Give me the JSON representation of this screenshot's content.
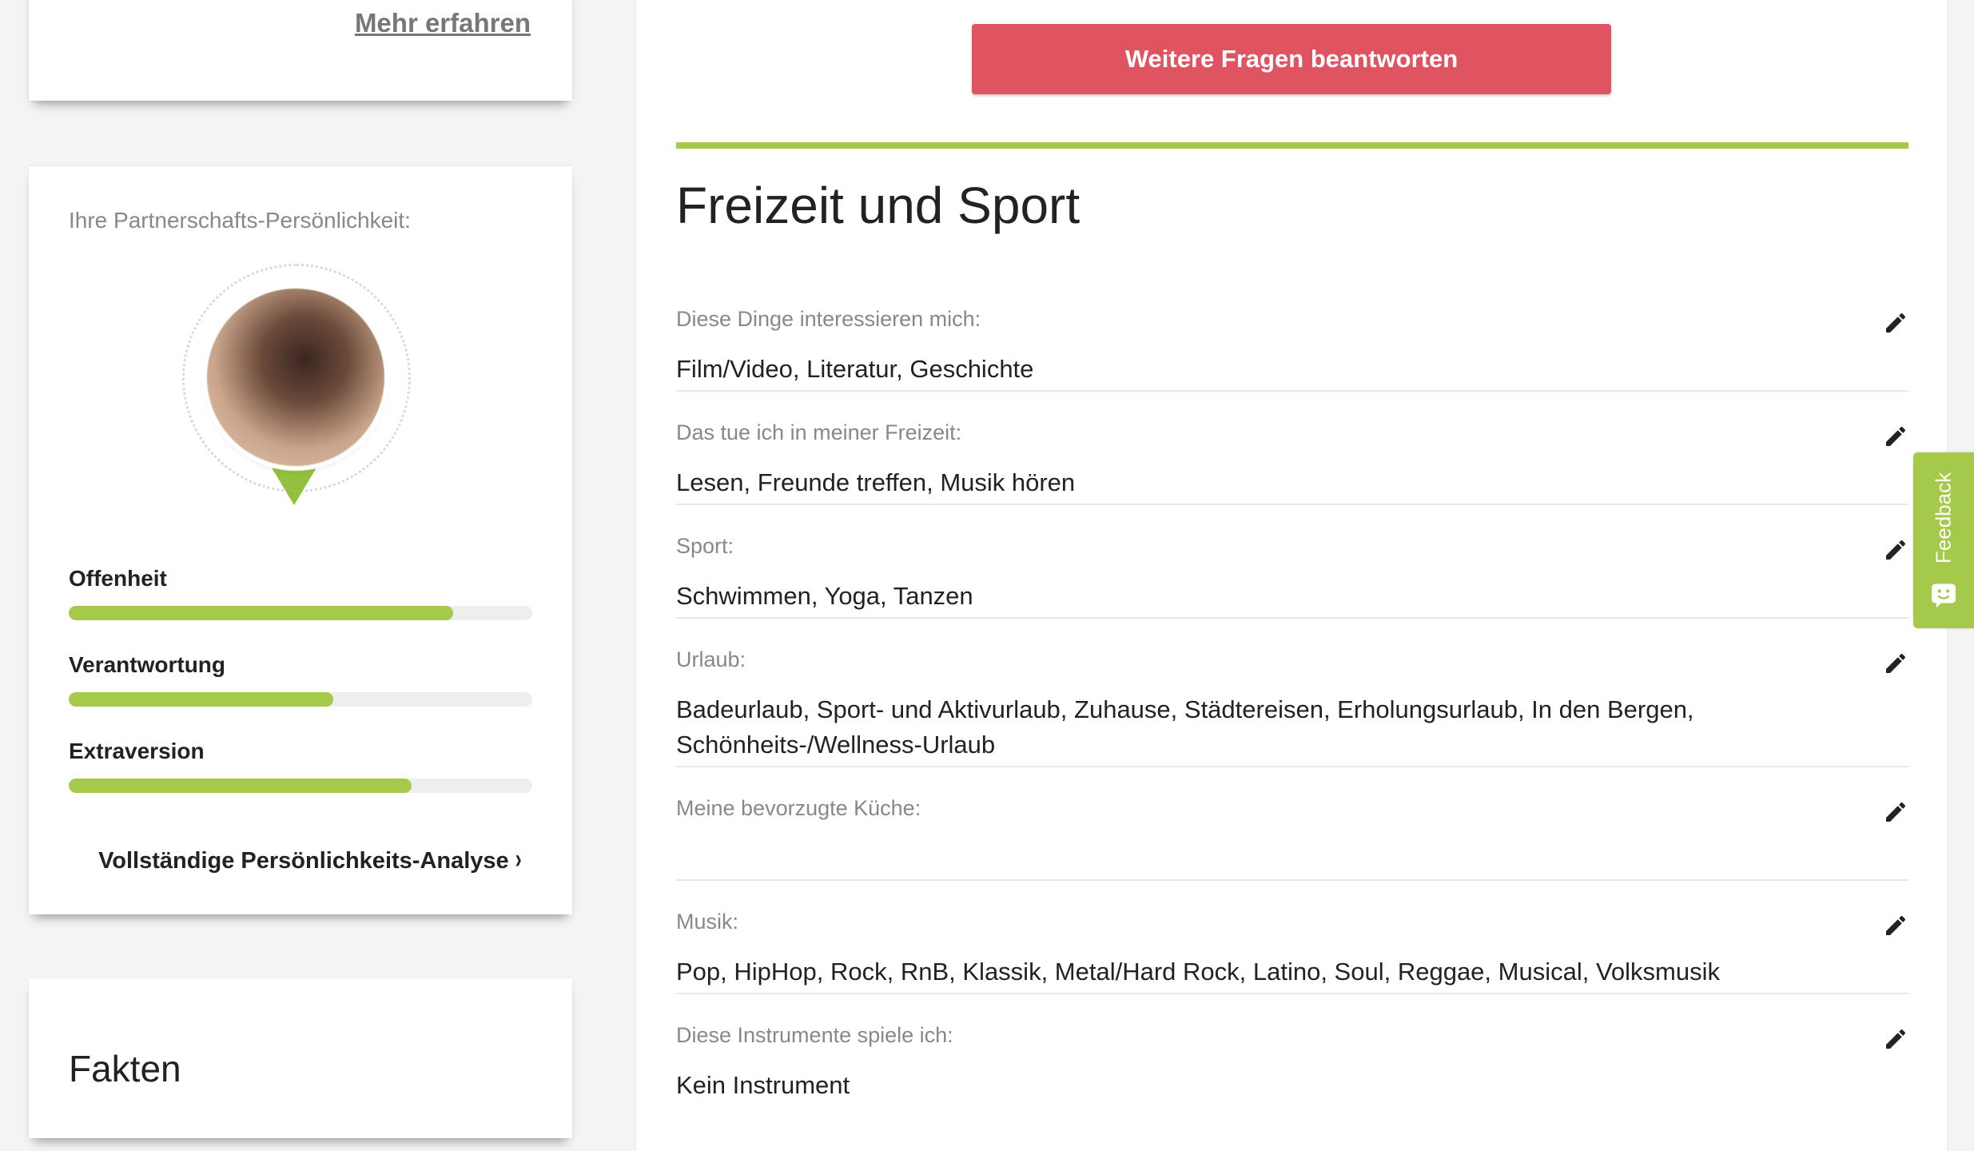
{
  "sidebar": {
    "more_link": "Mehr erfahren",
    "personality": {
      "title": "Ihre Partnerschafts-Persönlichkeit:",
      "traits": [
        {
          "label": "Offenheit",
          "value": 0.83
        },
        {
          "label": "Verantwortung",
          "value": 0.57
        },
        {
          "label": "Extraversion",
          "value": 0.74
        }
      ],
      "analysis_link": "Vollständige Persönlichkeits-Analyse",
      "chevron": "›"
    },
    "facts_title": "Fakten"
  },
  "main": {
    "questions_button": "Weitere Fragen beantworten",
    "section_title": "Freizeit und Sport",
    "rows": [
      {
        "label": "Diese Dinge interessieren mich:",
        "value": "Film/Video, Literatur, Geschichte"
      },
      {
        "label": "Das tue ich in meiner Freizeit:",
        "value": "Lesen, Freunde treffen, Musik hören"
      },
      {
        "label": "Sport:",
        "value": "Schwimmen, Yoga, Tanzen"
      },
      {
        "label": "Urlaub:",
        "value": "Badeurlaub, Sport- und Aktivurlaub, Zuhause, Städtereisen, Erholungsurlaub, In den Bergen, Schönheits-/Wellness-Urlaub"
      },
      {
        "label": "Meine bevorzugte Küche:",
        "value": ""
      },
      {
        "label": "Musik:",
        "value": "Pop, HipHop, Rock, RnB, Klassik, Metal/Hard Rock, Latino, Soul, Reggae, Musical, Volksmusik"
      },
      {
        "label": "Diese Instrumente spiele ich:",
        "value": "Kein Instrument"
      }
    ]
  },
  "feedback_tab": {
    "label": "Feedback"
  },
  "colors": {
    "accent_green": "#a5c94a",
    "button_red": "#e05462"
  }
}
